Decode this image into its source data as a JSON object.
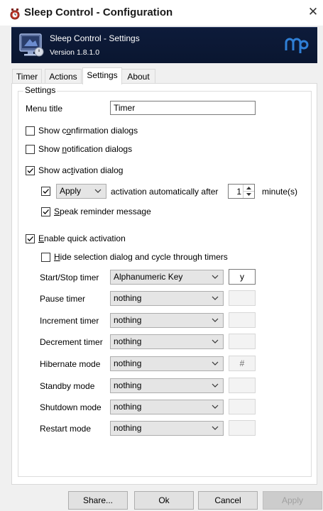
{
  "window": {
    "title": "Sleep Control - Configuration",
    "close_glyph": "✕"
  },
  "banner": {
    "title": "Sleep Control - Settings",
    "version": "Version 1.8.1.0"
  },
  "tabs": [
    {
      "label": "Timer",
      "active": false
    },
    {
      "label": "Actions",
      "active": false
    },
    {
      "label": "Settings",
      "active": true
    },
    {
      "label": "About",
      "active": false
    }
  ],
  "settings": {
    "group_label": "Settings",
    "menu_title_label": "Menu title",
    "menu_title_value": "Timer",
    "show_confirmation": {
      "label_pre": "Show c",
      "label_u": "o",
      "label_post": "nfirmation dialogs",
      "checked": false
    },
    "show_notification": {
      "label_pre": "Show ",
      "label_u": "n",
      "label_post": "otification dialogs",
      "checked": false
    },
    "show_activation": {
      "label_pre": "Show ac",
      "label_u": "t",
      "label_post": "ivation dialog",
      "checked": true
    },
    "apply_checkbox": {
      "checked": true
    },
    "apply_combo": {
      "value": "Apply"
    },
    "activation_text": "activation automatically after",
    "minutes_value": "1",
    "minutes_label": "minute(s)",
    "speak_reminder": {
      "label_u": "S",
      "label_post": "peak reminder message",
      "checked": true
    },
    "enable_quick": {
      "label_u": "E",
      "label_post": "nable quick activation",
      "checked": true
    },
    "hide_selection": {
      "label_u": "H",
      "label_post": "ide selection dialog and cycle through timers",
      "checked": false
    },
    "hotkeys": [
      {
        "label": "Start/Stop timer",
        "value": "Alphanumeric Key",
        "key": "y",
        "key_enabled": true
      },
      {
        "label": "Pause timer",
        "value": "nothing",
        "key": "",
        "key_enabled": false
      },
      {
        "label": "Increment timer",
        "value": "nothing",
        "key": "",
        "key_enabled": false
      },
      {
        "label": "Decrement timer",
        "value": "nothing",
        "key": "",
        "key_enabled": false
      },
      {
        "label": "Hibernate mode",
        "value": "nothing",
        "key": "#",
        "key_enabled": false
      },
      {
        "label": "Standby mode",
        "value": "nothing",
        "key": "",
        "key_enabled": false
      },
      {
        "label": "Shutdown mode",
        "value": "nothing",
        "key": "",
        "key_enabled": false
      },
      {
        "label": "Restart mode",
        "value": "nothing",
        "key": "",
        "key_enabled": false
      }
    ]
  },
  "buttons": {
    "share": "Share...",
    "ok": "Ok",
    "cancel": "Cancel",
    "apply": "Apply"
  },
  "colors": {
    "banner_bg": "#0d1b3a",
    "logo_blue": "#2f7fd6",
    "icon_red": "#c0392b"
  },
  "icons": [
    "sleep-control-app-icon",
    "close-icon",
    "monitor-icon",
    "brand-logo-icon",
    "chevron-down-icon",
    "checkmark-icon",
    "spin-arrows-icon"
  ]
}
